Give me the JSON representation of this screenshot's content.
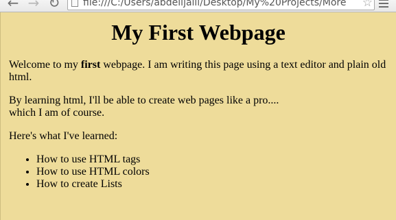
{
  "browser": {
    "url": "file:///C:/Users/abdelljalil/Desktop/My%20Projects/More"
  },
  "page": {
    "heading": "My First Webpage",
    "intro_before": "Welcome to my ",
    "intro_bold": "first",
    "intro_after": " webpage. I am writing this page using a text editor and plain old html.",
    "learning_line1": "By learning html, I'll be able to create web pages like a pro....",
    "learning_line2": "which I am of course.",
    "learned_heading": "Here's what I've learned:",
    "learned_items": [
      "How to use HTML tags",
      "How to use HTML colors",
      "How to create Lists"
    ],
    "background_color": "#EEDC9A"
  }
}
